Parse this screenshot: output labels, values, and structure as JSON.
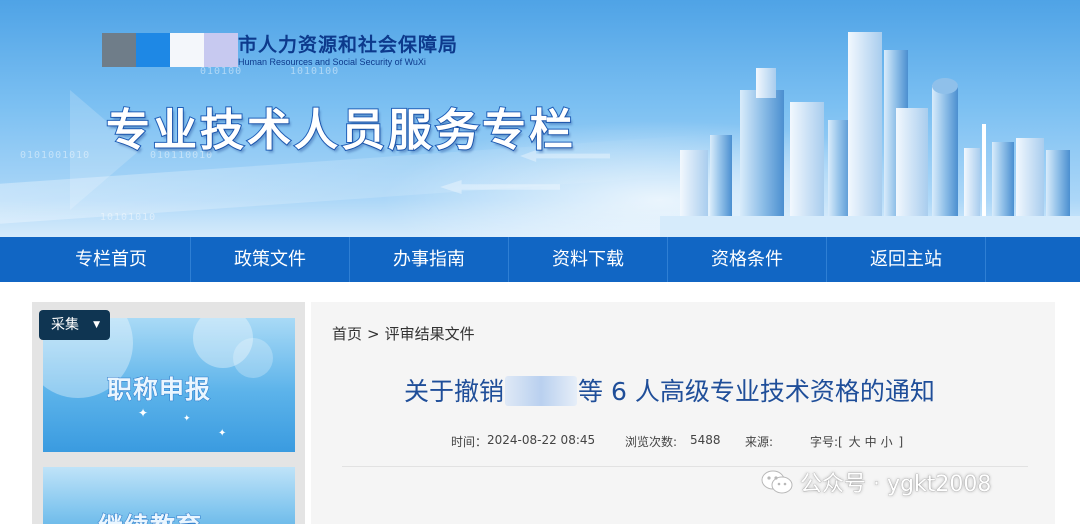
{
  "header": {
    "org_title": "市人力资源和社会保障局",
    "org_subtitle": "Human Resources and Social Security of WuXi",
    "banner_title": "专业技术人员服务专栏",
    "bg_digits": [
      "010100",
      "1010100",
      "0101001010",
      "010110010",
      "10101010"
    ]
  },
  "nav": {
    "items": [
      {
        "label": "专栏首页"
      },
      {
        "label": "政策文件"
      },
      {
        "label": "办事指南"
      },
      {
        "label": "资料下载"
      },
      {
        "label": "资格条件"
      },
      {
        "label": "返回主站"
      }
    ]
  },
  "sidebar": {
    "caiji_label": "采集",
    "caiji_icon": "caret-down-icon",
    "cards": [
      {
        "label": "职称申报"
      },
      {
        "label": "继续教育"
      }
    ]
  },
  "breadcrumb": {
    "home": "首页",
    "separator": ">",
    "current": "评审结果文件"
  },
  "article": {
    "title_prefix": "关于撤销",
    "title_suffix": "等 6 人高级专业技术资格的通知",
    "meta": {
      "time_label": "时间：",
      "time_value": "2024-08-22 08:45",
      "views_label": "浏览次数:",
      "views_value": "5488",
      "source_label": "来源:",
      "size_label": "字号:",
      "size_open": "[",
      "size_large": "大",
      "size_medium": "中",
      "size_small": "小",
      "size_close": "]"
    }
  },
  "watermark": {
    "icon": "wechat-icon",
    "text": "公众号 · ygkt2008"
  },
  "colors": {
    "nav_bg": "#1166c4",
    "title_blue": "#1f4e99",
    "caiji_bg": "#0f3552"
  }
}
